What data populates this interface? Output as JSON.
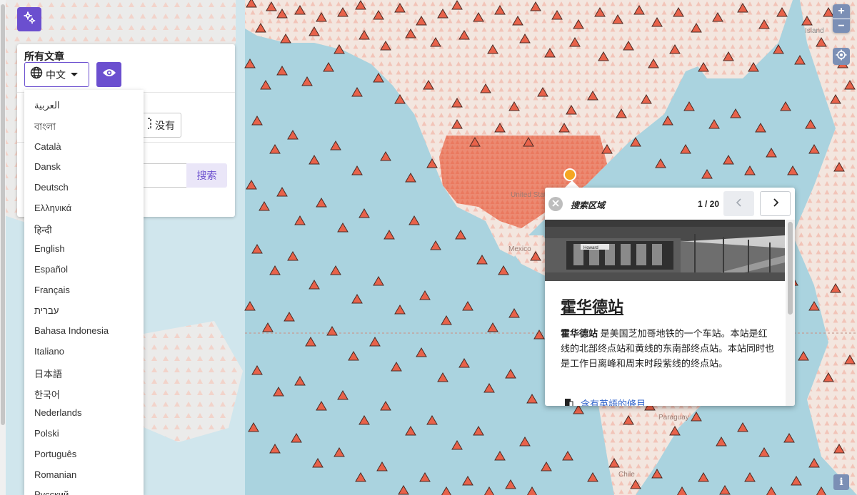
{
  "map": {
    "labels": {
      "united_states": "United States",
      "mexico": "Mexico",
      "island": "Island",
      "paraguay": "Paraguay",
      "chile": "Chile"
    }
  },
  "controls": {
    "settings_icon": "gears-icon",
    "zoom_in": "+",
    "zoom_out": "−",
    "info": "i"
  },
  "filter_panel": {
    "title": "所有文章",
    "language_selected": "中文",
    "none_label": "没有",
    "search_button": "搜索"
  },
  "language_options": [
    "العربية",
    "বাংলা",
    "Català",
    "Dansk",
    "Deutsch",
    "Ελληνικά",
    "हिन्दी",
    "English",
    "Español",
    "Français",
    "עברית",
    "Bahasa Indonesia",
    "Italiano",
    "日本語",
    "한국어",
    "Nederlands",
    "Polski",
    "Português",
    "Romanian",
    "Русский"
  ],
  "popup": {
    "area_label": "搜索区域",
    "count": "1 / 20",
    "title": "霍华德站",
    "text_bold": "霍华德站",
    "text_rest": " 是美国芝加哥地铁的一个车站。本站是红线的北部终点站和黄线的东南部终点站。本站同时也是工作日离峰和周末时段紫线的终点站。",
    "english_link": "含有英語的條目",
    "photo_sign": "Howard"
  },
  "colors": {
    "accent": "#6b4fcf",
    "marker": "#e8624a",
    "water": "#aad3df",
    "land": "#f3e9e4"
  }
}
